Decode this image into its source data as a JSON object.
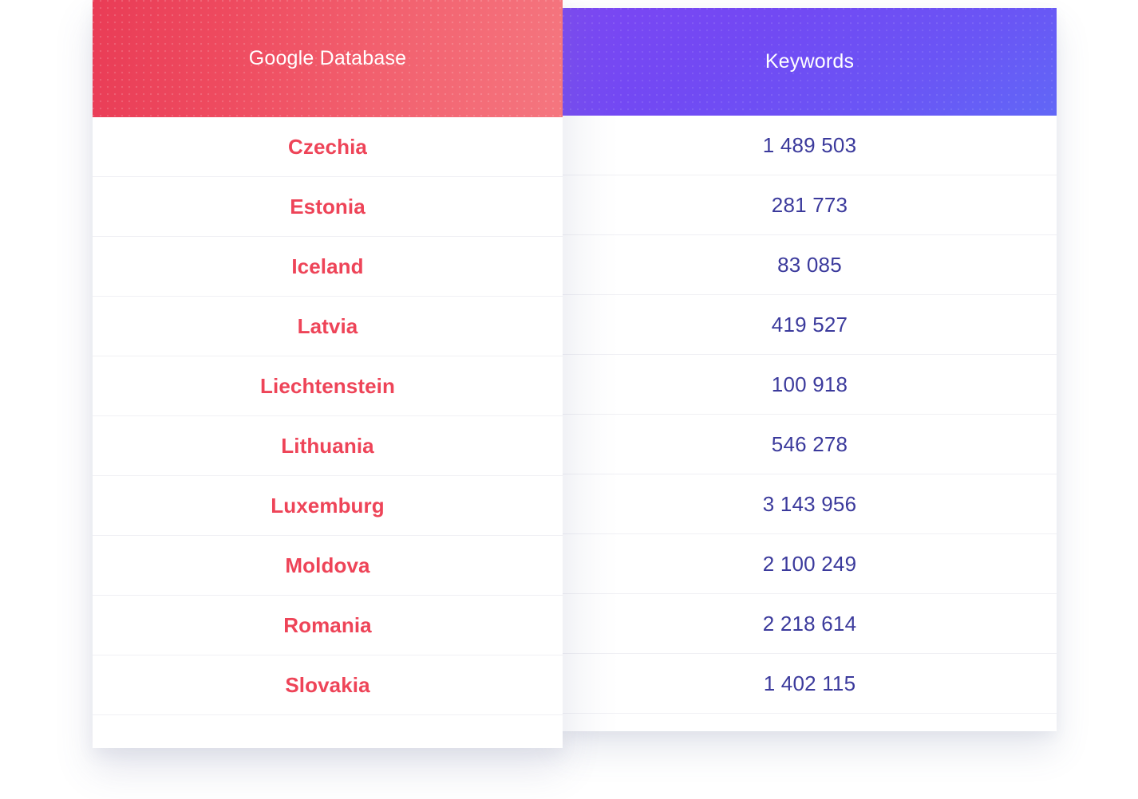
{
  "table": {
    "columns": [
      {
        "id": "google-database",
        "label": "Google Database",
        "accent": "#ee4458",
        "header_gradient_from": "#e93c56",
        "header_gradient_to": "#f5767f"
      },
      {
        "id": "keywords",
        "label": "Keywords",
        "accent": "#3b3a9c",
        "header_gradient_from": "#7b46f3",
        "header_gradient_to": "#6167f6"
      }
    ],
    "rows": [
      {
        "country": "Czechia",
        "keywords": "1 489 503"
      },
      {
        "country": "Estonia",
        "keywords": "281 773"
      },
      {
        "country": "Iceland",
        "keywords": "83 085"
      },
      {
        "country": "Latvia",
        "keywords": "419 527"
      },
      {
        "country": "Liechtenstein",
        "keywords": "100 918"
      },
      {
        "country": "Lithuania",
        "keywords": "546 278"
      },
      {
        "country": "Luxemburg",
        "keywords": "3 143 956"
      },
      {
        "country": "Moldova",
        "keywords": "2 100 249"
      },
      {
        "country": "Romania",
        "keywords": "2 218 614"
      },
      {
        "country": "Slovakia",
        "keywords": "1 402 115"
      }
    ]
  },
  "chart_data": {
    "type": "table",
    "title": "",
    "columns": [
      "Google Database",
      "Keywords"
    ],
    "categories": [
      "Czechia",
      "Estonia",
      "Iceland",
      "Latvia",
      "Liechtenstein",
      "Lithuania",
      "Luxemburg",
      "Moldova",
      "Romania",
      "Slovakia"
    ],
    "series": [
      {
        "name": "Keywords",
        "values": [
          1489503,
          281773,
          83085,
          419527,
          100918,
          546278,
          3143956,
          2100249,
          2218614,
          1402115
        ]
      }
    ],
    "value_labels": [
      "1 489 503",
      "281 773",
      "83 085",
      "419 527",
      "100 918",
      "546 278",
      "3 143 956",
      "2 100 249",
      "2 218 614",
      "1 402 115"
    ],
    "xlabel": "Google Database",
    "ylabel": "Keywords"
  }
}
